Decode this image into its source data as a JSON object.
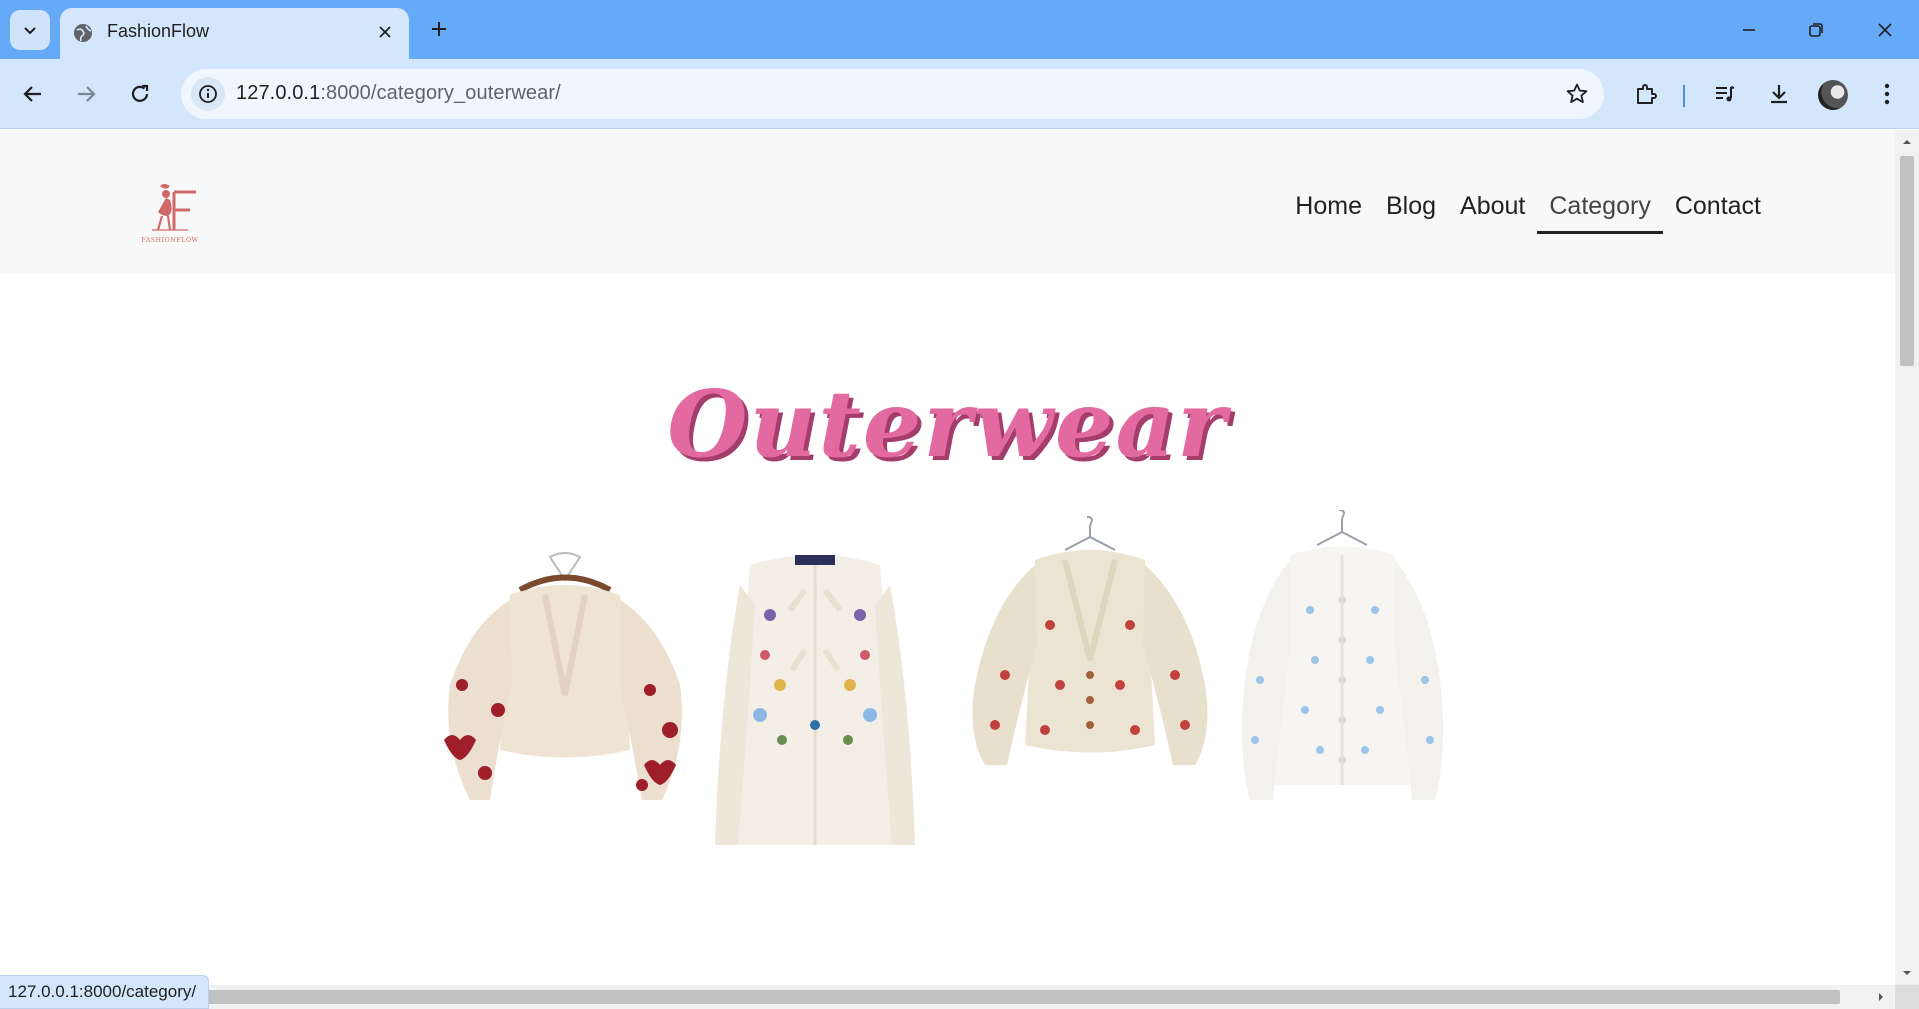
{
  "browser": {
    "tab_title": "FashionFlow",
    "url_host": "127.0.0.1",
    "url_path": ":8000/category_outerwear/",
    "status_url": "127.0.0.1:8000/category/"
  },
  "site": {
    "logo_text": "FASHIONFLOW",
    "nav": [
      {
        "label": "Home"
      },
      {
        "label": "Blog"
      },
      {
        "label": "About"
      },
      {
        "label": "Category",
        "active": true
      },
      {
        "label": "Contact"
      }
    ],
    "section_title": "Outerwear",
    "products": [
      {
        "name": "cream cardigan with red hearts"
      },
      {
        "name": "ivory cardigan with floral embroidery and bows"
      },
      {
        "name": "beige cardigan with embroidered flowers"
      },
      {
        "name": "white cardigan with blue stars"
      }
    ]
  },
  "colors": {
    "tabbar": "#64aaf9",
    "toolbar": "#d3e6fc",
    "title_pink": "#e26aa0",
    "logo": "#d06a6a"
  }
}
